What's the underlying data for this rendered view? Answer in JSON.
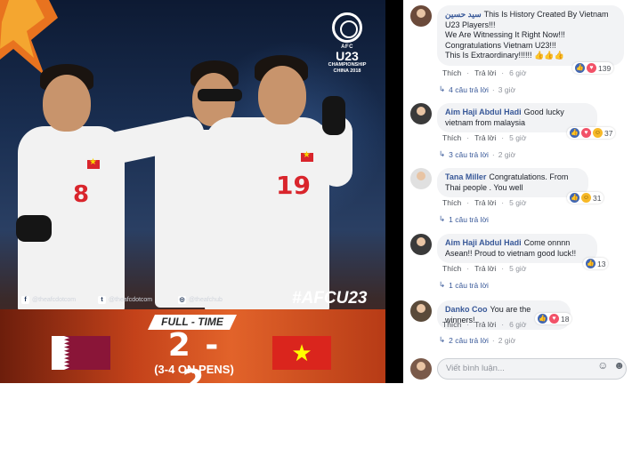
{
  "graphic": {
    "afc_small": "AFC",
    "afc_big": "U23",
    "afc_championship": "CHAMPIONSHIP",
    "afc_host": "CHINA 2018",
    "social_facebook": "@theafcdotcom",
    "social_twitter": "@theafcdotcom",
    "social_instagram": "@theafchub",
    "hashtag": "#AFCU23",
    "full_time": "FULL - TIME",
    "score": "2 - 2",
    "pens": "(3-4 ON PENS)",
    "player_numbers": [
      "8",
      "19"
    ]
  },
  "comments": [
    {
      "author": "سيد حسين",
      "text_lines": [
        "This Is History Created By Vietnam U23 Players!!!",
        "We Are Witnessing It Right Now!!!",
        "Congratulations Vietnam U23!!!",
        "This Is Extraordinary!!!!!! 👍👍👍"
      ],
      "like": "Thích",
      "reply": "Trả lời",
      "time": "6 giờ",
      "reaction_count": "139",
      "replies_label": "4 câu trả lời",
      "replies_time": "3 giờ"
    },
    {
      "author": "Aim Haji Abdul Hadi",
      "text_lines": [
        "Good lucky vietnam from malaysia"
      ],
      "like": "Thích",
      "reply": "Trả lời",
      "time": "5 giờ",
      "reaction_count": "37",
      "replies_label": "3 câu trả lời",
      "replies_time": "2 giờ"
    },
    {
      "author": "Tana Miller",
      "text_lines": [
        "Congratulations. From Thai people . You well"
      ],
      "like": "Thích",
      "reply": "Trả lời",
      "time": "5 giờ",
      "reaction_count": "31",
      "replies_label": "1 câu trả lời",
      "replies_time": ""
    },
    {
      "author": "Aim Haji Abdul Hadi",
      "text_lines": [
        "Come onnnn Asean!! Proud to vietnam good luck!!"
      ],
      "like": "Thích",
      "reply": "Trả lời",
      "time": "5 giờ",
      "reaction_count": "13",
      "replies_label": "1 câu trả lời",
      "replies_time": ""
    },
    {
      "author": "Danko Coo",
      "text_lines": [
        "You are the winners!"
      ],
      "like": "Thích",
      "reply": "Trả lời",
      "time": "6 giờ",
      "reaction_count": "18",
      "replies_label": "2 câu trả lời",
      "replies_time": "2 giờ"
    }
  ],
  "write_comment": {
    "placeholder": "Viết bình luận..."
  },
  "colors": {
    "link": "#385898",
    "bubble": "#f2f3f5",
    "like": "#4267b2",
    "love": "#f25268"
  }
}
